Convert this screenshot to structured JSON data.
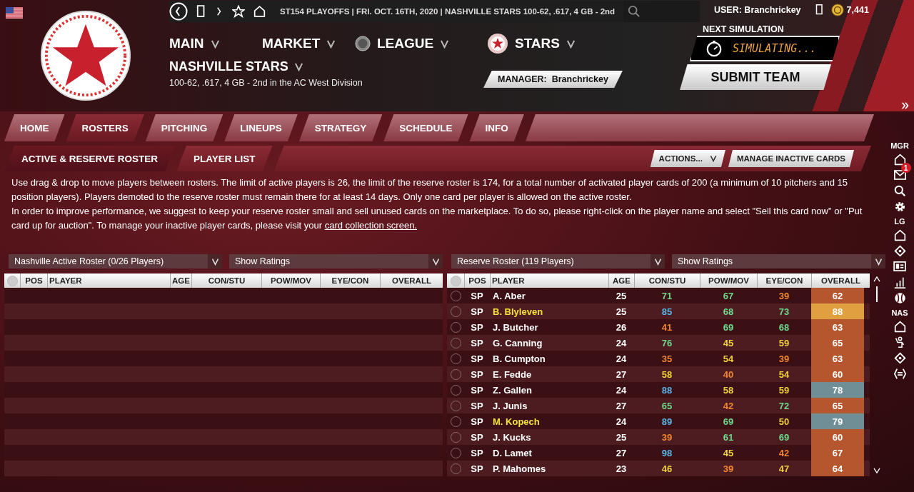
{
  "top_bar": {
    "status": "ST154 PLAYOFFS  |  FRI. OCT. 16TH, 2020  |  NASHVILLE STARS  100-62, .617, 4 GB - 2nd",
    "user": "USER: Branchrickey",
    "coins": "7,441"
  },
  "main_menu": [
    {
      "label": "MAIN",
      "kind": "plain"
    },
    {
      "label": "MARKET",
      "kind": "plain"
    },
    {
      "label": "LEAGUE",
      "kind": "league"
    },
    {
      "label": "STARS",
      "kind": "team"
    }
  ],
  "team": {
    "name": "NASHVILLE STARS",
    "record": "100-62, .617, 4 GB - 2nd in the AC West Division",
    "manager_label": "MANAGER:",
    "manager": "Branchrickey"
  },
  "simulation": {
    "label": "NEXT SIMULATION",
    "status": "SIMULATING...",
    "submit": "SUBMIT TEAM"
  },
  "tabs": [
    {
      "label": "HOME",
      "selected": false
    },
    {
      "label": "ROSTERS",
      "selected": true
    },
    {
      "label": "PITCHING",
      "selected": false
    },
    {
      "label": "LINEUPS",
      "selected": false
    },
    {
      "label": "STRATEGY",
      "selected": false
    },
    {
      "label": "SCHEDULE",
      "selected": false
    },
    {
      "label": "INFO",
      "selected": false
    }
  ],
  "subtabs": [
    {
      "label": "ACTIVE & RESERVE ROSTER",
      "selected": true
    },
    {
      "label": "PLAYER LIST",
      "selected": false
    }
  ],
  "actions": {
    "menu": "ACTIONS...",
    "manage": "MANAGE INACTIVE CARDS"
  },
  "info": {
    "paragraph_1": "Use drag & drop to move players between rosters. The limit of active players is 26, the limit of the reserve roster is 174, for a total number of activated player cards of 200 (a minimum of 10 pitchers and 15 position players). Players demoted to the reserve roster must remain there for at least 14 days. Only one card per player is allowed on the active roster.",
    "paragraph_2": "In order to improve performance, we suggest to keep your reserve roster small and sell unused cards on the marketplace. To do so, please right-click on the player name and select \"Sell this card now\" or \"Put card up for auction\". To manage your inactive player cards, please visit your",
    "link": "card collection screen."
  },
  "active_roster": {
    "title": "Nashville Active Roster (0/26 Players)",
    "view": "Show Ratings",
    "select_all": {
      "selected": false
    },
    "columns": [
      "POS",
      "PLAYER",
      "AGE",
      "CON/STU",
      "POW/MOV",
      "EYE/CON",
      "OVERALL"
    ]
  },
  "reserve_roster": {
    "title": "Reserve Roster (119 Players)",
    "view": "Show Ratings",
    "select_all": {
      "selected": false
    },
    "columns": [
      "POS",
      "PLAYER",
      "AGE",
      "CON/STU",
      "POW/MOV",
      "EYE/CON",
      "OVERALL"
    ],
    "rows": [
      {
        "selected": false,
        "pos": "SP",
        "player": "A. Aber",
        "highlighted": false,
        "age": "25",
        "ratings": [
          {
            "value": "71",
            "color": "#6fd98c"
          },
          {
            "value": "67",
            "color": "#6fd98c"
          },
          {
            "value": "39",
            "color": "#f0862e"
          }
        ],
        "overall": {
          "value": "62",
          "color": "#b5562e"
        }
      },
      {
        "selected": false,
        "pos": "SP",
        "player": "B. Blyleven",
        "highlighted": true,
        "age": "25",
        "ratings": [
          {
            "value": "85",
            "color": "#5bb6e8"
          },
          {
            "value": "68",
            "color": "#6fd98c"
          },
          {
            "value": "73",
            "color": "#6fd98c"
          }
        ],
        "overall": {
          "value": "88",
          "color": "#e0a040"
        }
      },
      {
        "selected": false,
        "pos": "SP",
        "player": "J. Butcher",
        "highlighted": false,
        "age": "26",
        "ratings": [
          {
            "value": "41",
            "color": "#f0862e"
          },
          {
            "value": "69",
            "color": "#6fd98c"
          },
          {
            "value": "68",
            "color": "#6fd98c"
          }
        ],
        "overall": {
          "value": "63",
          "color": "#b5562e"
        }
      },
      {
        "selected": false,
        "pos": "SP",
        "player": "G. Canning",
        "highlighted": false,
        "age": "24",
        "ratings": [
          {
            "value": "76",
            "color": "#6fd98c"
          },
          {
            "value": "45",
            "color": "#f0d23c"
          },
          {
            "value": "59",
            "color": "#f0d23c"
          }
        ],
        "overall": {
          "value": "65",
          "color": "#b5562e"
        }
      },
      {
        "selected": false,
        "pos": "SP",
        "player": "B. Cumpton",
        "highlighted": false,
        "age": "24",
        "ratings": [
          {
            "value": "35",
            "color": "#f0862e"
          },
          {
            "value": "54",
            "color": "#f0d23c"
          },
          {
            "value": "39",
            "color": "#f0862e"
          }
        ],
        "overall": {
          "value": "63",
          "color": "#b5562e"
        }
      },
      {
        "selected": false,
        "pos": "SP",
        "player": "E. Fedde",
        "highlighted": false,
        "age": "27",
        "ratings": [
          {
            "value": "58",
            "color": "#f0d23c"
          },
          {
            "value": "40",
            "color": "#f0862e"
          },
          {
            "value": "54",
            "color": "#f0d23c"
          }
        ],
        "overall": {
          "value": "60",
          "color": "#b5562e"
        }
      },
      {
        "selected": false,
        "pos": "SP",
        "player": "Z. Gallen",
        "highlighted": false,
        "age": "24",
        "ratings": [
          {
            "value": "88",
            "color": "#5bb6e8"
          },
          {
            "value": "58",
            "color": "#f0d23c"
          },
          {
            "value": "59",
            "color": "#f0d23c"
          }
        ],
        "overall": {
          "value": "78",
          "color": "#6f8e96"
        }
      },
      {
        "selected": false,
        "pos": "SP",
        "player": "J. Junis",
        "highlighted": false,
        "age": "27",
        "ratings": [
          {
            "value": "65",
            "color": "#6fd98c"
          },
          {
            "value": "42",
            "color": "#f0862e"
          },
          {
            "value": "72",
            "color": "#6fd98c"
          }
        ],
        "overall": {
          "value": "65",
          "color": "#b5562e"
        }
      },
      {
        "selected": false,
        "pos": "SP",
        "player": "M. Kopech",
        "highlighted": true,
        "age": "24",
        "ratings": [
          {
            "value": "89",
            "color": "#5bb6e8"
          },
          {
            "value": "69",
            "color": "#6fd98c"
          },
          {
            "value": "50",
            "color": "#f0d23c"
          }
        ],
        "overall": {
          "value": "79",
          "color": "#6f8e96"
        }
      },
      {
        "selected": false,
        "pos": "SP",
        "player": "J. Kucks",
        "highlighted": false,
        "age": "25",
        "ratings": [
          {
            "value": "39",
            "color": "#f0862e"
          },
          {
            "value": "61",
            "color": "#6fd98c"
          },
          {
            "value": "69",
            "color": "#6fd98c"
          }
        ],
        "overall": {
          "value": "60",
          "color": "#b5562e"
        }
      },
      {
        "selected": false,
        "pos": "SP",
        "player": "D. Lamet",
        "highlighted": false,
        "age": "27",
        "ratings": [
          {
            "value": "98",
            "color": "#5bb6e8"
          },
          {
            "value": "45",
            "color": "#f0d23c"
          },
          {
            "value": "42",
            "color": "#f0862e"
          }
        ],
        "overall": {
          "value": "67",
          "color": "#b5562e"
        }
      },
      {
        "selected": false,
        "pos": "SP",
        "player": "P. Mahomes",
        "highlighted": false,
        "age": "23",
        "ratings": [
          {
            "value": "46",
            "color": "#f0d23c"
          },
          {
            "value": "39",
            "color": "#f0862e"
          },
          {
            "value": "47",
            "color": "#f0d23c"
          }
        ],
        "overall": {
          "value": "64",
          "color": "#b5562e"
        }
      }
    ]
  },
  "sidebar": [
    {
      "label": "MGR",
      "icons": [
        {
          "kind": "home"
        },
        {
          "kind": "mail",
          "badge": "1"
        },
        {
          "kind": "search"
        },
        {
          "kind": "settings"
        }
      ]
    },
    {
      "label": "LG",
      "icons": [
        {
          "kind": "home"
        },
        {
          "kind": "diamond"
        },
        {
          "kind": "card"
        },
        {
          "kind": "chart"
        },
        {
          "kind": "ball"
        }
      ]
    },
    {
      "label": "NAS",
      "icons": [
        {
          "kind": "home"
        },
        {
          "kind": "player"
        },
        {
          "kind": "diamond"
        },
        {
          "kind": "swap"
        }
      ]
    }
  ]
}
